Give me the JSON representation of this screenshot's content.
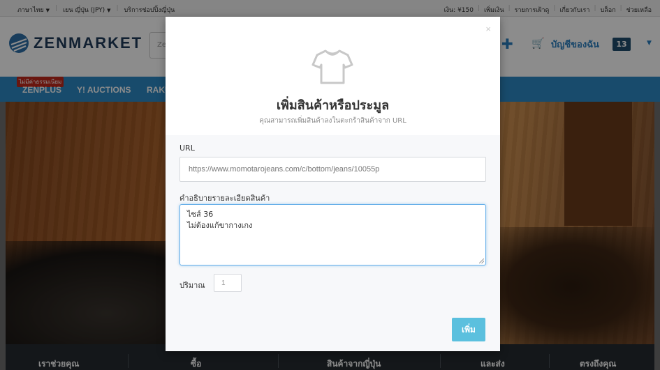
{
  "topbar": {
    "language": "ภาษาไทย",
    "currency": "เยน ญี่ปุ่น (JPY)",
    "service": "บริการช่อปปิ้งญี่ปุ่น",
    "balance": "เงิน: ¥150",
    "top_up": "เพิ่มเงิน",
    "wishlist": "รายการเฝ้าดู",
    "about": "เกี่ยวกับเรา",
    "blog": "บล็อก",
    "help": "ช่วยเหลือ"
  },
  "header": {
    "logo_text": "ZENMARKET",
    "search_placeholder": "Ze",
    "account_label": "บัญชีของฉัน",
    "cart_count": "13"
  },
  "nav": {
    "badge": "ไม่มีค่าธรรมเนียม",
    "items": [
      "ZENPLUS",
      "Y! AUCTIONS",
      "RAKU"
    ]
  },
  "footer_bar": {
    "items": [
      "เราช่วยคุณ",
      "ซื้อ",
      "สินค้าจากญี่ปุ่น",
      "และส่ง",
      "ตรงถึงคุณ"
    ]
  },
  "modal": {
    "close_symbol": "×",
    "icon": "tshirt-icon",
    "title": "เพิ่มสินค้าหรือประมูล",
    "subtitle": "คุณสามารถเพิ่มสินค้าลงในตะกร้าสินค้าจาก URL",
    "url_label": "URL",
    "url_value": "https://www.momotarojeans.com/c/bottom/jeans/10055p",
    "desc_label": "คำอธิบายรายละเอียดสินค้า",
    "desc_line1": "ไซส์ 36",
    "desc_line2": "ไม่ต้องแก้ขากางเกง",
    "qty_label": "ปริมาณ",
    "qty_value": "1",
    "submit_label": "เพิ่ม"
  },
  "colors": {
    "nav_blue": "#2c89c5",
    "button_blue": "#5bc0de",
    "logo_navy": "#1f3b5a"
  }
}
